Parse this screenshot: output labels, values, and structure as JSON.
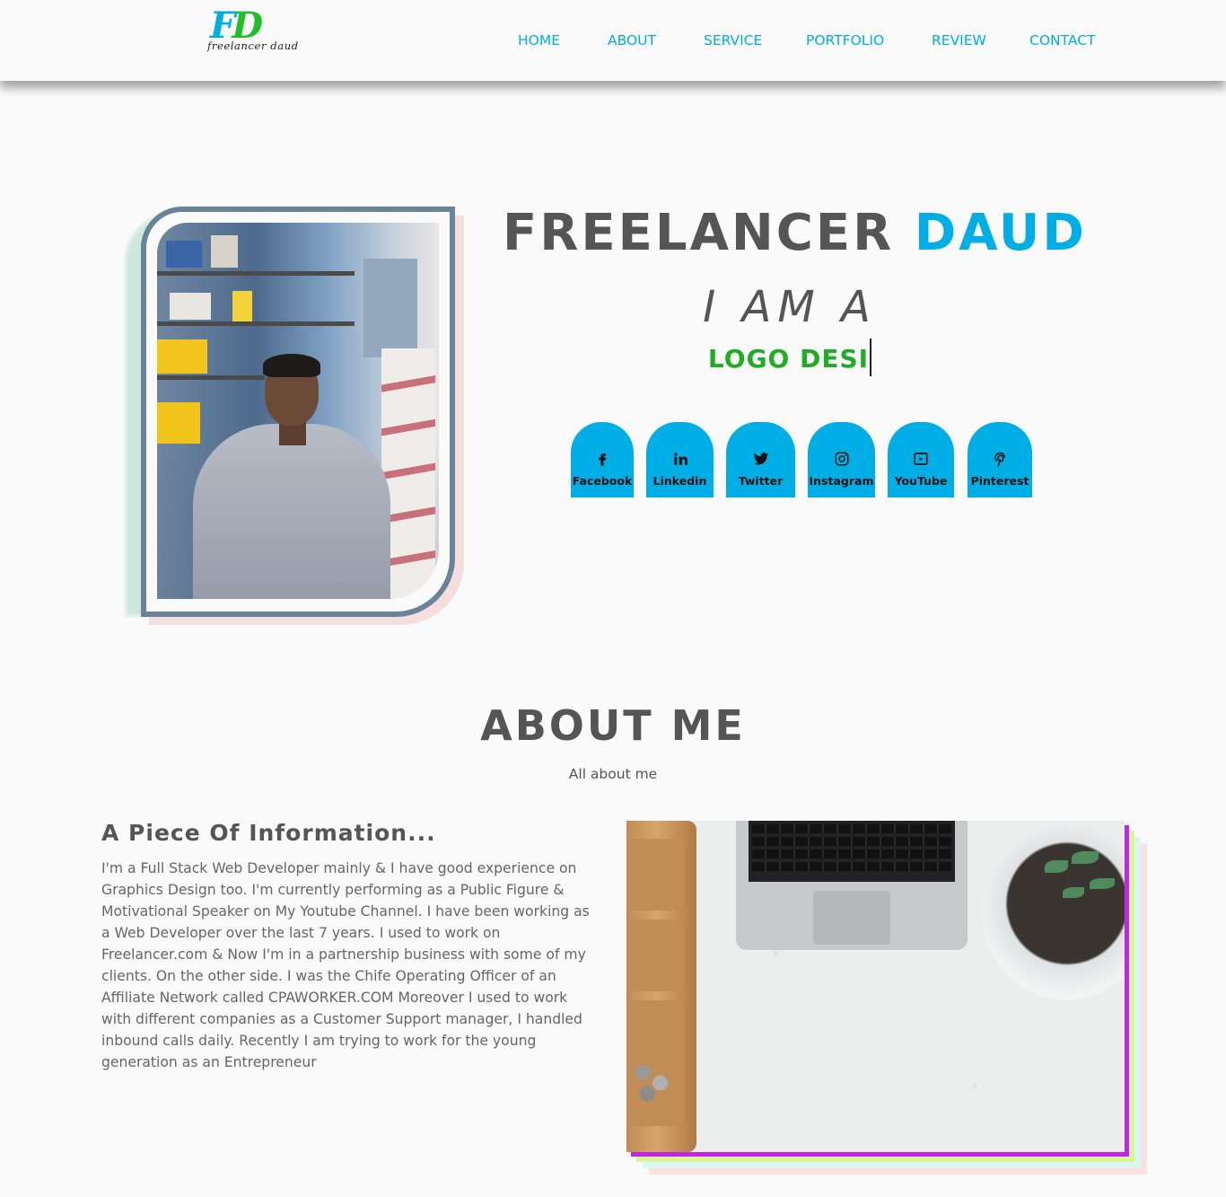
{
  "brand": {
    "logo_letter_f": "F",
    "logo_letter_d": "D",
    "logo_tagline": "freelancer daud",
    "accent_color": "#00aee6",
    "green_color": "#1fad24"
  },
  "nav": {
    "items": [
      {
        "label": "HOME"
      },
      {
        "label": "ABOUT"
      },
      {
        "label": "SERVICE"
      },
      {
        "label": "PORTFOLIO"
      },
      {
        "label": "REVIEW"
      },
      {
        "label": "CONTACT"
      }
    ]
  },
  "hero": {
    "title_first": "FREELANCER",
    "title_last": "DAUD",
    "iam": "I AM A",
    "role_typed": "LOGO DESI",
    "social": [
      {
        "label": "Facebook",
        "icon": "facebook-icon"
      },
      {
        "label": "Linkedin",
        "icon": "linkedin-icon"
      },
      {
        "label": "Twitter",
        "icon": "twitter-icon"
      },
      {
        "label": "Instagram",
        "icon": "instagram-icon"
      },
      {
        "label": "YouTube",
        "icon": "youtube-icon"
      },
      {
        "label": "Pinterest",
        "icon": "pinterest-icon"
      }
    ]
  },
  "about": {
    "title": "ABOUT ME",
    "subtitle": "All about me",
    "heading": "A Piece Of Information...",
    "body": "I'm a Full Stack Web Developer mainly & I have good experience on Graphics Design too. I'm currently performing as a Public Figure & Motivational Speaker on My Youtube Channel. I have been working as a Web Developer over the last 7 years. I used to work on Freelancer.com & Now I'm in a partnership business with some of my clients. On the other side. I was the Chife Operating Officer of an Affiliate Network called CPAWORKER.COM Moreover I used to work with different companies as a Customer Support manager, I handled inbound calls daily. Recently I am trying to work for the young generation as an Entrepreneur"
  }
}
